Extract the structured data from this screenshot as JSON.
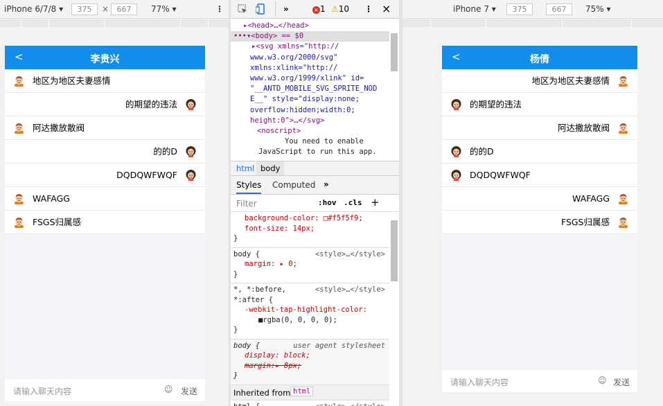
{
  "left_panel": {
    "device": "iPhone 6/7/8",
    "width": "375",
    "times": "×",
    "height": "667",
    "zoom": "77%",
    "chat": {
      "title": "李贵兴",
      "back": "<",
      "messages": [
        {
          "text": "地区为地区夫妻感情",
          "side": "left",
          "avatar": "male"
        },
        {
          "text": "的期望的违法",
          "side": "right",
          "avatar": "female"
        },
        {
          "text": "阿达撒放散阀",
          "side": "left",
          "avatar": "male"
        },
        {
          "text": "的的D",
          "side": "right",
          "avatar": "female"
        },
        {
          "text": "DQDQWFWQF",
          "side": "right",
          "avatar": "female"
        },
        {
          "text": "WAFAGG",
          "side": "left",
          "avatar": "male"
        },
        {
          "text": "FSGS归属感",
          "side": "left",
          "avatar": "male"
        }
      ],
      "input_placeholder": "请输入聊天内容",
      "emoji": "☺",
      "send": "发送"
    }
  },
  "right_panel": {
    "device": "iPhone 7",
    "width": "375",
    "height": "667",
    "zoom": "75%",
    "chat": {
      "title": "杨倩",
      "back": "<",
      "messages": [
        {
          "text": "地区为地区夫妻感情",
          "side": "right",
          "avatar": "male"
        },
        {
          "text": "的期望的违法",
          "side": "left",
          "avatar": "female"
        },
        {
          "text": "阿达撒放散阀",
          "side": "right",
          "avatar": "male"
        },
        {
          "text": "的的D",
          "side": "left",
          "avatar": "female"
        },
        {
          "text": "DQDQWFWQF",
          "side": "left",
          "avatar": "female"
        },
        {
          "text": "WAFAGG",
          "side": "right",
          "avatar": "male"
        },
        {
          "text": "FSGS归属感",
          "side": "right",
          "avatar": "male"
        }
      ],
      "input_placeholder": "请输入聊天内容",
      "emoji": "☺",
      "send": "发送"
    }
  },
  "devtools": {
    "more": "»",
    "errors": "1",
    "warnings": "10",
    "close": "×",
    "elements": [
      "▸<head>…</head>",
      "•••▾<body> == $0",
      "▸<svg xmlns=\"http://",
      "www.w3.org/2000/svg\"",
      "xmlns:xlink=\"http://",
      "www.w3.org/1999/xlink\" id=",
      "\"__ANTD_MOBILE_SVG_SPRITE_NOD",
      "E__\" style=\"display:none;",
      "overflow:hidden;width:0;",
      "height:0\">…</svg>",
      "<noscript>",
      "You need to enable",
      "JavaScript to run this app."
    ],
    "breadcrumbs": [
      "html",
      "body"
    ],
    "style_tabs": [
      "Styles",
      "Computed",
      "»"
    ],
    "filter_placeholder": "Filter",
    "hov": ":hov",
    ".cls": ".cls",
    "plus": "+",
    "rules": [
      {
        "selector": "",
        "lines": [
          "background-color: □#f5f5f9;",
          "font-size: 14px;",
          "}"
        ],
        "source": ""
      },
      {
        "selector": "body {",
        "lines": [
          "margin: ▸ 0;",
          "}"
        ],
        "source": "<style>…</style>"
      },
      {
        "selector": "*, *:before,",
        "lines": [
          "*:after {",
          "-webkit-tap-highlight-color:",
          "■rgba(0, 0, 0, 0);",
          "}"
        ],
        "source": "<style>…</style>"
      },
      {
        "selector": "body {",
        "lines": [
          "display: block;",
          "margin:▸ 8px;",
          "}"
        ],
        "source": "user agent stylesheet"
      }
    ],
    "inherited_label": "Inherited from",
    "inherited_tag": "html",
    "last_rule": {
      "selector": "html {",
      "source": "<style>…</style>"
    }
  }
}
